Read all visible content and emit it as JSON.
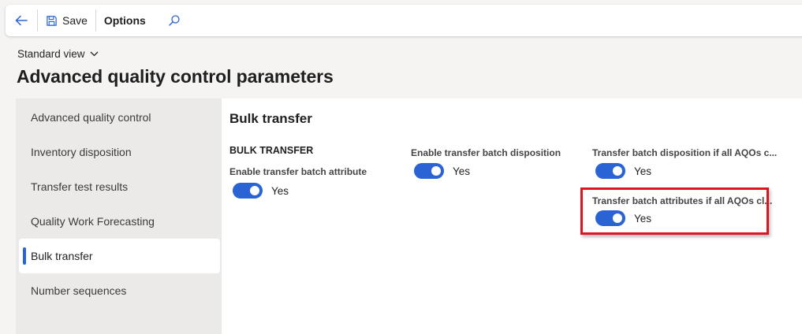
{
  "toolbar": {
    "save_label": "Save",
    "options_label": "Options"
  },
  "icons": {
    "back": "back-arrow-icon",
    "save": "save-icon",
    "search": "search-icon",
    "chevron": "chevron-down-icon"
  },
  "view": {
    "label": "Standard view"
  },
  "page": {
    "title": "Advanced quality control parameters"
  },
  "nav": {
    "items": [
      {
        "label": "Advanced quality control"
      },
      {
        "label": "Inventory disposition"
      },
      {
        "label": "Transfer test results"
      },
      {
        "label": "Quality Work Forecasting"
      },
      {
        "label": "Bulk transfer"
      },
      {
        "label": "Number sequences"
      }
    ],
    "active_index": 4
  },
  "main": {
    "section_title": "Bulk transfer",
    "group_heading": "BULK TRANSFER",
    "fields": [
      {
        "label": "Enable transfer batch attribute",
        "value": "Yes"
      },
      {
        "label": "Enable transfer batch disposition",
        "value": "Yes"
      },
      {
        "label": "Transfer batch disposition if all AQOs c...",
        "value": "Yes"
      },
      {
        "label": "Transfer batch attributes if all AQOs cl...",
        "value": "Yes"
      }
    ]
  },
  "colors": {
    "accent": "#2a63d4",
    "highlight": "#e0141e",
    "background": "#f5f4f3",
    "nav_background": "#ebeae9"
  }
}
